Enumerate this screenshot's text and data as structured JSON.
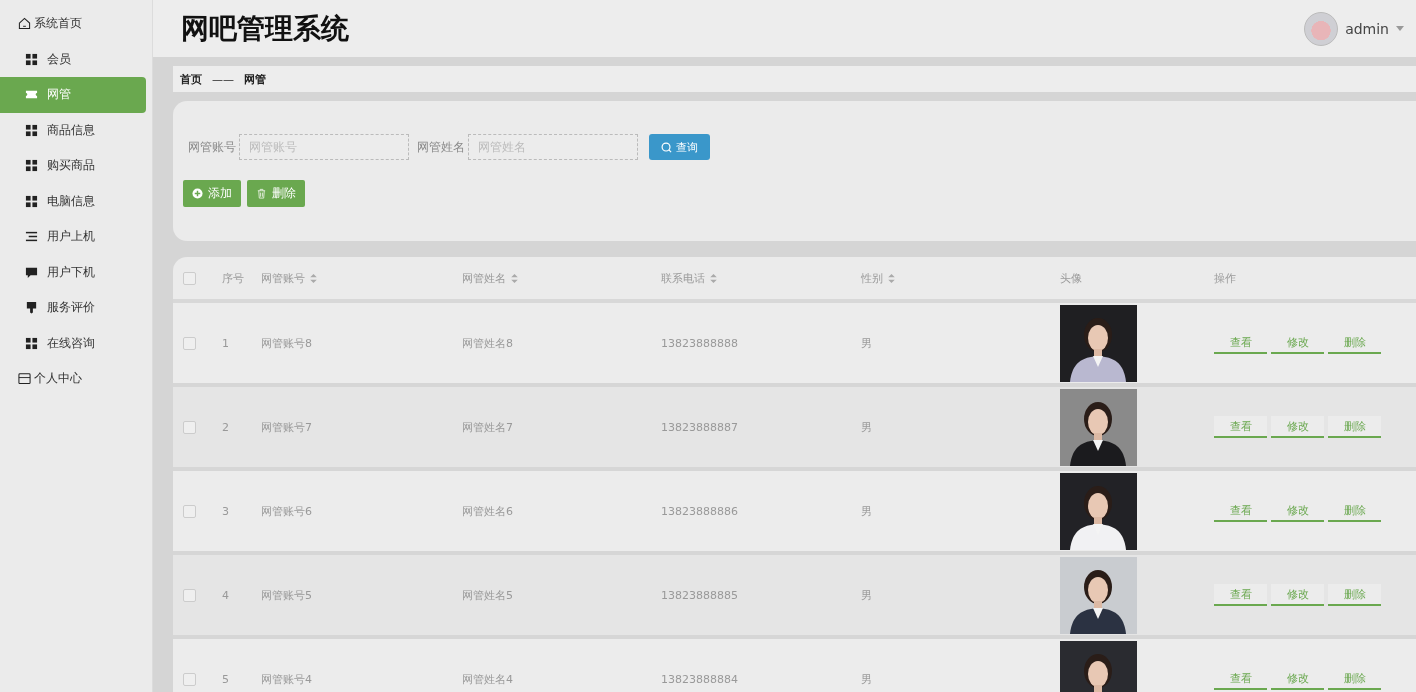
{
  "header": {
    "title": "网吧管理系统",
    "user": "admin"
  },
  "sidebar": {
    "home": {
      "label": "系统首页",
      "selected": false
    },
    "items": [
      {
        "label": "会员",
        "kind": "grid",
        "selected": false
      },
      {
        "label": "网管",
        "kind": "ticket",
        "selected": true
      },
      {
        "label": "商品信息",
        "kind": "grid",
        "selected": false
      },
      {
        "label": "购买商品",
        "kind": "grid",
        "selected": false
      },
      {
        "label": "电脑信息",
        "kind": "grid",
        "selected": false
      },
      {
        "label": "用户上机",
        "kind": "list",
        "selected": false
      },
      {
        "label": "用户下机",
        "kind": "chat",
        "selected": false
      },
      {
        "label": "服务评价",
        "kind": "pin",
        "selected": false
      },
      {
        "label": "在线咨询",
        "kind": "grid",
        "selected": false
      }
    ],
    "profile": {
      "label": "个人中心",
      "selected": false
    }
  },
  "breadcrumb": {
    "home": "首页",
    "separator": "——",
    "current": "网管"
  },
  "search": {
    "fields": [
      {
        "label": "网管账号",
        "placeholder": "网管账号"
      },
      {
        "label": "网管姓名",
        "placeholder": "网管姓名"
      }
    ],
    "button": "查询"
  },
  "actions": [
    {
      "label": "添加",
      "kind": "add"
    },
    {
      "label": "删除",
      "kind": "delete"
    }
  ],
  "table": {
    "all_checked": false,
    "columns": [
      {
        "label": "序号",
        "sortable": false
      },
      {
        "label": "网管账号",
        "sortable": true
      },
      {
        "label": "网管姓名",
        "sortable": true
      },
      {
        "label": "联系电话",
        "sortable": true
      },
      {
        "label": "性别",
        "sortable": true
      },
      {
        "label": "头像",
        "sortable": false
      },
      {
        "label": "操作",
        "sortable": false
      }
    ],
    "rows": [
      {
        "checked": false,
        "index": "1",
        "account": "网管账号8",
        "name": "网管姓名8",
        "phone": "13823888888",
        "gender": "男",
        "actions": [
          "查看",
          "修改",
          "删除"
        ]
      },
      {
        "checked": false,
        "index": "2",
        "account": "网管账号7",
        "name": "网管姓名7",
        "phone": "13823888887",
        "gender": "男",
        "actions": [
          "查看",
          "修改",
          "删除"
        ]
      },
      {
        "checked": false,
        "index": "3",
        "account": "网管账号6",
        "name": "网管姓名6",
        "phone": "13823888886",
        "gender": "男",
        "actions": [
          "查看",
          "修改",
          "删除"
        ]
      },
      {
        "checked": false,
        "index": "4",
        "account": "网管账号5",
        "name": "网管姓名5",
        "phone": "13823888885",
        "gender": "男",
        "actions": [
          "查看",
          "修改",
          "删除"
        ]
      },
      {
        "checked": false,
        "index": "5",
        "account": "网管账号4",
        "name": "网管姓名4",
        "phone": "13823888884",
        "gender": "男",
        "actions": [
          "查看",
          "修改",
          "删除"
        ]
      }
    ]
  }
}
